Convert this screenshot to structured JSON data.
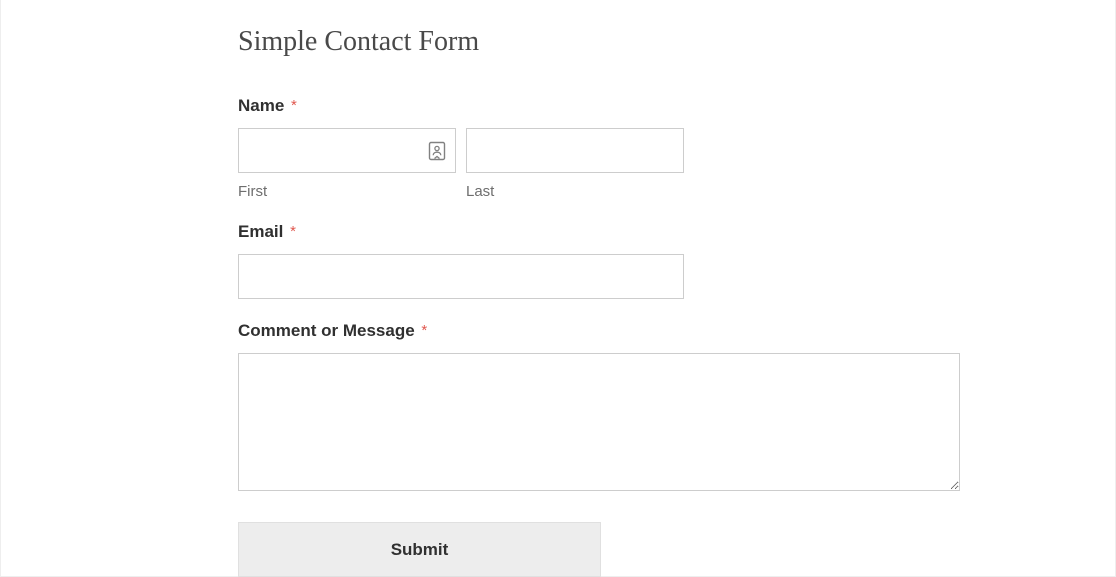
{
  "form": {
    "title": "Simple Contact Form",
    "name": {
      "label": "Name",
      "first_sub": "First",
      "last_sub": "Last",
      "first_value": "",
      "last_value": ""
    },
    "email": {
      "label": "Email",
      "value": ""
    },
    "comment": {
      "label": "Comment or Message",
      "value": ""
    },
    "submit_label": "Submit",
    "required_mark": "*"
  }
}
